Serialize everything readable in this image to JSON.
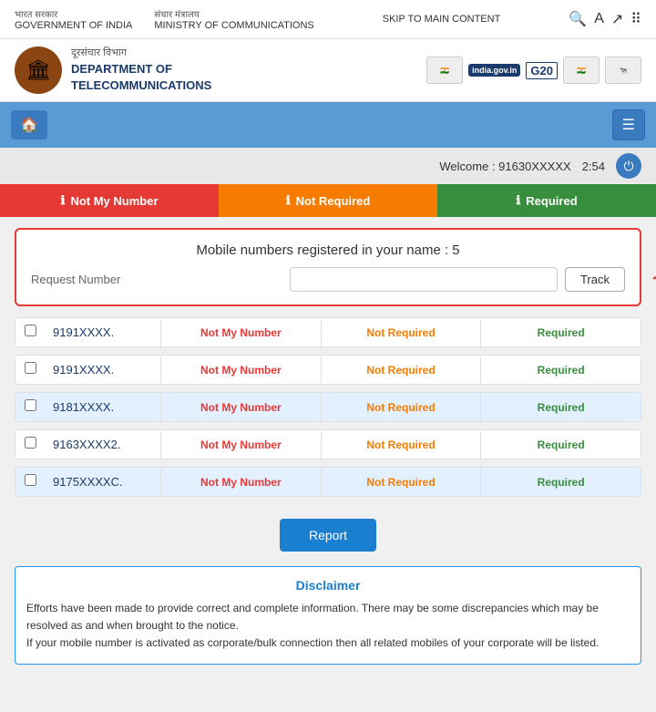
{
  "topbar": {
    "gov_hindi": "भारत सरकार",
    "gov_english": "GOVERNMENT OF INDIA",
    "ministry_hindi": "संचार मंत्रालय",
    "ministry_english": "MINISTRY OF COMMUNICATIONS",
    "skip_label": "SKIP TO MAIN CONTENT"
  },
  "header": {
    "dept_hindi": "दूरसंचार विभाग",
    "dept_line1": "DEPARTMENT OF",
    "dept_line2": "TELECOMMUNICATIONS",
    "logo_g20": "G20",
    "logo_india": "india.gov.in"
  },
  "nav": {
    "home_icon": "🏠",
    "menu_icon": "☰"
  },
  "welcome": {
    "label": "Welcome : 91630",
    "masked": "XXXXX",
    "time": "2:54",
    "power_icon": "⏻"
  },
  "tabs": [
    {
      "id": "not-my-number",
      "label": "Not My Number",
      "icon": "ℹ",
      "color": "tab-red"
    },
    {
      "id": "not-required",
      "label": "Not Required",
      "icon": "ℹ",
      "color": "tab-orange"
    },
    {
      "id": "required",
      "label": "Required",
      "icon": "ℹ",
      "color": "tab-green"
    }
  ],
  "mobile_box": {
    "title": "Mobile numbers registered in your name : 5",
    "request_label": "Request Number",
    "track_btn": "Track"
  },
  "phone_list": [
    {
      "number": "9191XXXX.",
      "alt": false
    },
    {
      "number": "9191XXXX.",
      "alt": false
    },
    {
      "number": "9181XXXX.",
      "alt": true
    },
    {
      "number": "9163XXXX2.",
      "alt": false
    },
    {
      "number": "9175XXXXC.",
      "alt": true
    }
  ],
  "action_buttons": {
    "not_my_number": "Not My Number",
    "not_required": "Not Required",
    "required": "Required"
  },
  "report": {
    "btn_label": "Report"
  },
  "disclaimer": {
    "title": "Disclaimer",
    "text": "Efforts have been made to provide correct and complete information. There may be some discrepancies which may be resolved as and when brought to the notice.\n If your mobile number is activated as corporate/bulk connection then all related mobiles of your corporate will be listed."
  }
}
